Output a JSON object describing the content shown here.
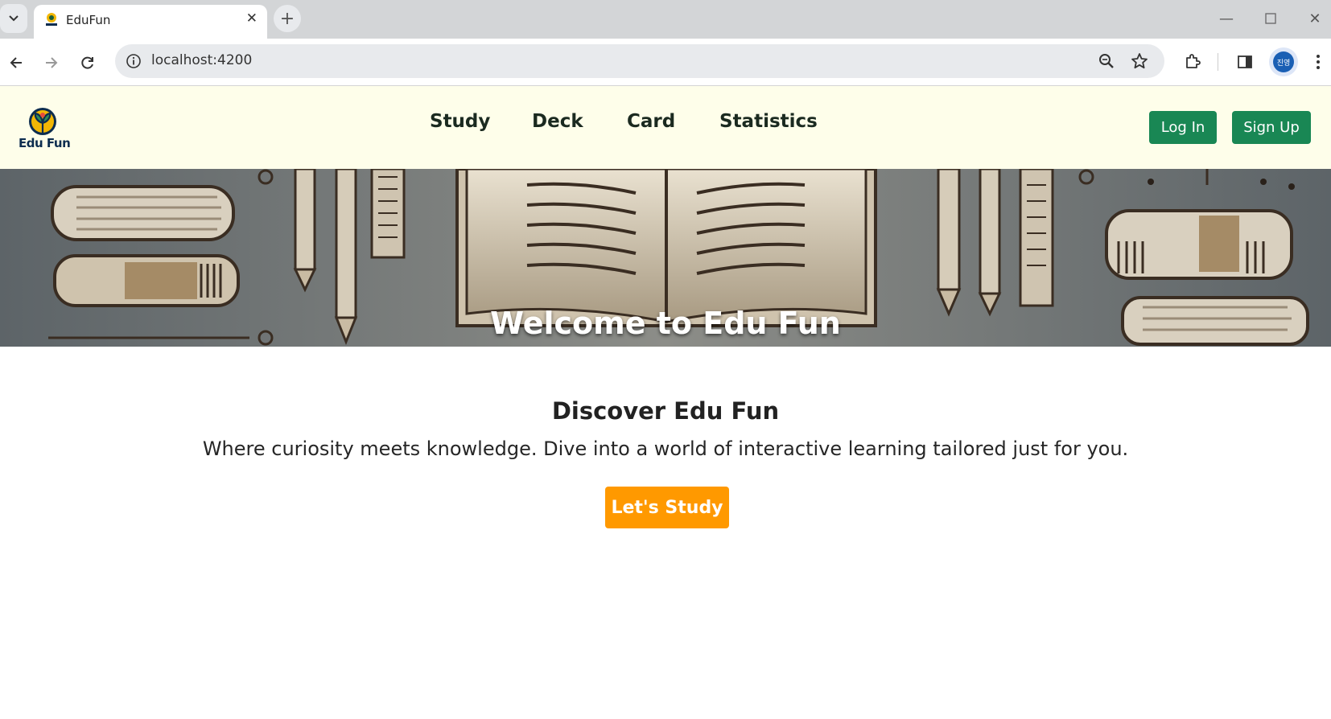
{
  "browser": {
    "tab_title": "EduFun",
    "url": "localhost:4200",
    "profile_label": "진영"
  },
  "header": {
    "logo_text": "Edu Fun",
    "nav": [
      "Study",
      "Deck",
      "Card",
      "Statistics"
    ],
    "login_label": "Log In",
    "signup_label": "Sign Up"
  },
  "hero": {
    "title": "Welcome to Edu Fun"
  },
  "main": {
    "title": "Discover Edu Fun",
    "subtitle": "Where curiosity meets knowledge. Dive into a world of interactive learning tailored just for you.",
    "cta_label": "Let's Study"
  },
  "colors": {
    "header_bg": "#fefeea",
    "green_button": "#198754",
    "cta_orange": "#ff9900"
  }
}
